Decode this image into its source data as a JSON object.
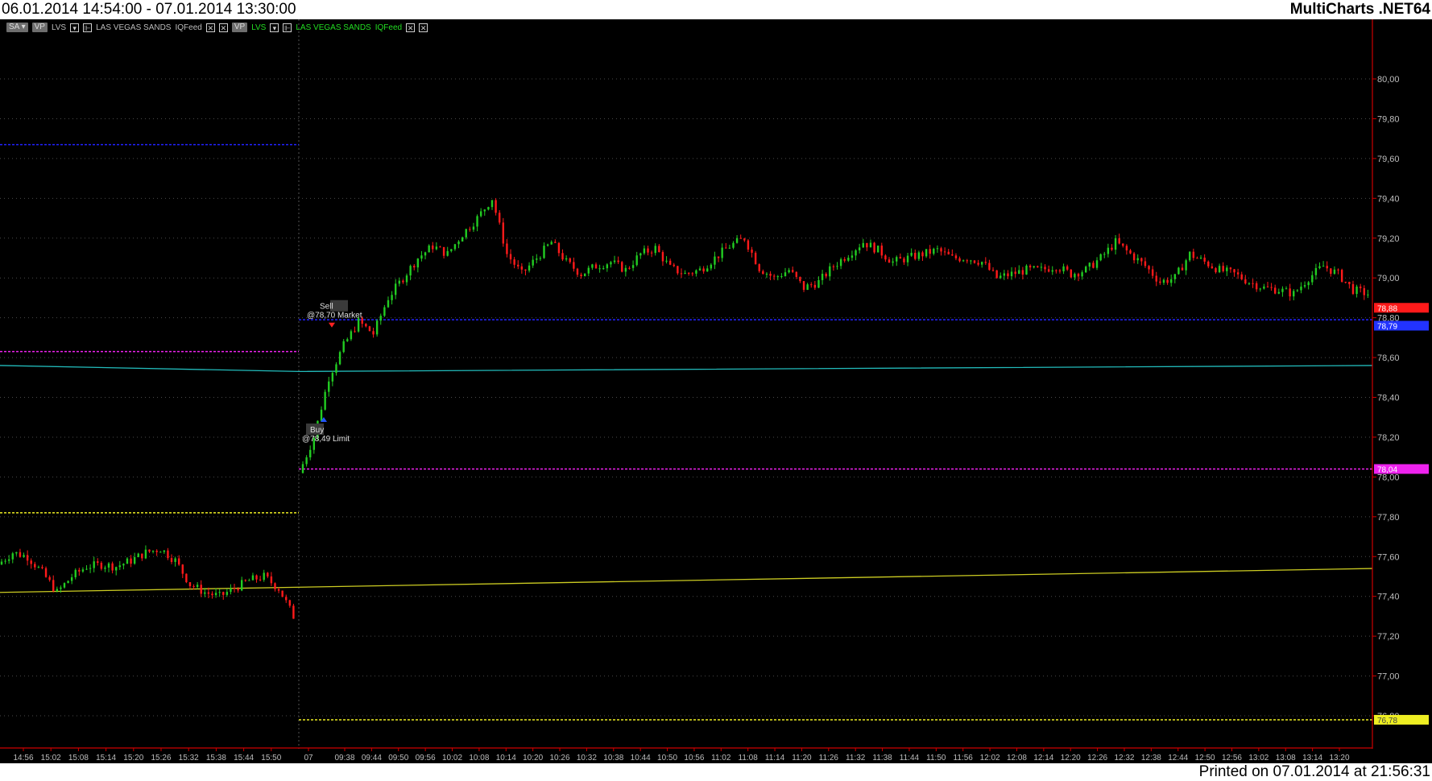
{
  "header": {
    "range_title": "06.01.2014 14:54:00 - 07.01.2014 13:30:00",
    "app_title": "MultiCharts .NET64"
  },
  "footer": {
    "printed": "Printed on 07.01.2014 at 21:56:31"
  },
  "legend": [
    {
      "kind": "tag",
      "text": "SA ▾"
    },
    {
      "kind": "tag",
      "text": "VP"
    },
    {
      "kind": "grey",
      "text": "LVS"
    },
    {
      "kind": "sq",
      "text": "▾"
    },
    {
      "kind": "sq",
      "text": "⊩"
    },
    {
      "kind": "grey",
      "text": "LAS VEGAS SANDS"
    },
    {
      "kind": "grey",
      "text": "IQFeed"
    },
    {
      "kind": "sq",
      "text": "✕"
    },
    {
      "kind": "sq",
      "text": "✕"
    },
    {
      "kind": "tag",
      "text": "VP"
    },
    {
      "kind": "green",
      "text": "LVS"
    },
    {
      "kind": "sq",
      "text": "▾"
    },
    {
      "kind": "sq",
      "text": "⊩"
    },
    {
      "kind": "green",
      "text": "LAS VEGAS SANDS"
    },
    {
      "kind": "green",
      "text": "IQFeed"
    },
    {
      "kind": "sq",
      "text": "✕"
    },
    {
      "kind": "sq",
      "text": "✕"
    }
  ],
  "chart_data": {
    "type": "candlestick",
    "y_ticks": [
      "80,00",
      "79,80",
      "79,60",
      "79,40",
      "79,20",
      "79,00",
      "78,80",
      "78,60",
      "78,40",
      "78,20",
      "78,00",
      "77,80",
      "77,60",
      "77,40",
      "77,20",
      "77,00",
      "76,80"
    ],
    "y_tick_values": [
      80.0,
      79.8,
      79.6,
      79.4,
      79.2,
      79.0,
      78.8,
      78.6,
      78.4,
      78.2,
      78.0,
      77.8,
      77.6,
      77.4,
      77.2,
      77.0,
      76.8
    ],
    "x_ticks_day1": [
      "14:56",
      "15:02",
      "15:08",
      "15:14",
      "15:20",
      "15:26",
      "15:32",
      "15:38",
      "15:44",
      "15:50"
    ],
    "x_ticks_day2": [
      "07",
      "09:38",
      "09:44",
      "09:50",
      "09:56",
      "10:02",
      "10:08",
      "10:14",
      "10:20",
      "10:26",
      "10:32",
      "10:38",
      "10:44",
      "10:50",
      "10:56",
      "11:02",
      "11:08",
      "11:14",
      "11:20",
      "11:26",
      "11:32",
      "11:38",
      "11:44",
      "11:50",
      "11:56",
      "12:02",
      "12:08",
      "12:14",
      "12:20",
      "12:26",
      "12:32",
      "12:38",
      "12:44",
      "12:50",
      "12:56",
      "13:02",
      "13:08",
      "13:14",
      "13:20"
    ],
    "colors": {
      "up": "#22cc22",
      "down": "#ff1a1a",
      "axis": "#cc0000",
      "grid": "#4a4a4a"
    },
    "day1_points": [
      77.56,
      77.62,
      77.6,
      77.52,
      77.42,
      77.5,
      77.55,
      77.56,
      77.55,
      77.58,
      77.62,
      77.64,
      77.58,
      77.46,
      77.42,
      77.4,
      77.44,
      77.48,
      77.5,
      77.44,
      77.3
    ],
    "day2_points": [
      78.02,
      78.2,
      78.5,
      78.66,
      78.78,
      78.72,
      78.9,
      79.0,
      79.1,
      79.16,
      79.12,
      79.22,
      79.3,
      79.4,
      79.12,
      79.02,
      79.1,
      79.18,
      79.08,
      79.02,
      79.06,
      79.08,
      79.04,
      79.12,
      79.15,
      79.05,
      79.02,
      79.04,
      79.1,
      79.16,
      79.2,
      79.05,
      79.0,
      79.04,
      78.95,
      78.98,
      79.06,
      79.12,
      79.18,
      79.14,
      79.08,
      79.1,
      79.12,
      79.14,
      79.1,
      79.1,
      79.08,
      79.0,
      79.02,
      79.04,
      79.04,
      79.06,
      79.02,
      79.04,
      79.1,
      79.18,
      79.12,
      79.06,
      78.98,
      79.0,
      79.12,
      79.08,
      79.04,
      79.02,
      78.98,
      78.95,
      78.94,
      78.92,
      79.0,
      79.06,
      79.02,
      78.94,
      78.92
    ],
    "levels": [
      {
        "color": "#2222ff",
        "style": "dash",
        "value": 79.67,
        "part": "day1"
      },
      {
        "color": "#ee22ee",
        "style": "dash",
        "value": 78.63,
        "part": "day1"
      },
      {
        "color": "#eeee22",
        "style": "dash",
        "value": 77.82,
        "part": "day1"
      },
      {
        "color": "#2222ff",
        "style": "dash",
        "value": 78.79,
        "part": "day2"
      },
      {
        "color": "#ee22ee",
        "style": "dash",
        "value": 78.04,
        "part": "day2"
      },
      {
        "color": "#eeee22",
        "style": "dash",
        "value": 76.78,
        "part": "day2"
      }
    ],
    "value_labels": [
      {
        "text": "78,88",
        "color": "#ff1a1a",
        "value": 78.85
      },
      {
        "text": "78,79",
        "color": "#2233ff",
        "value": 78.76
      },
      {
        "text": "78,04",
        "color": "#ee22ee",
        "value": 78.04
      },
      {
        "text": "76,78",
        "color": "#eeee22",
        "value": 76.78
      }
    ],
    "annotations": [
      {
        "line1": "Sell",
        "line2": "@78,70 Market",
        "value": 78.84
      },
      {
        "line1": "Buy",
        "line2": "@78,49 Limit",
        "value": 78.22
      }
    ],
    "lines": [
      {
        "color": "#22bbbb",
        "from": 78.56,
        "mid": 78.53,
        "to": 78.56
      },
      {
        "color": "#cccc22",
        "from": 77.42,
        "to": 77.54
      }
    ]
  }
}
